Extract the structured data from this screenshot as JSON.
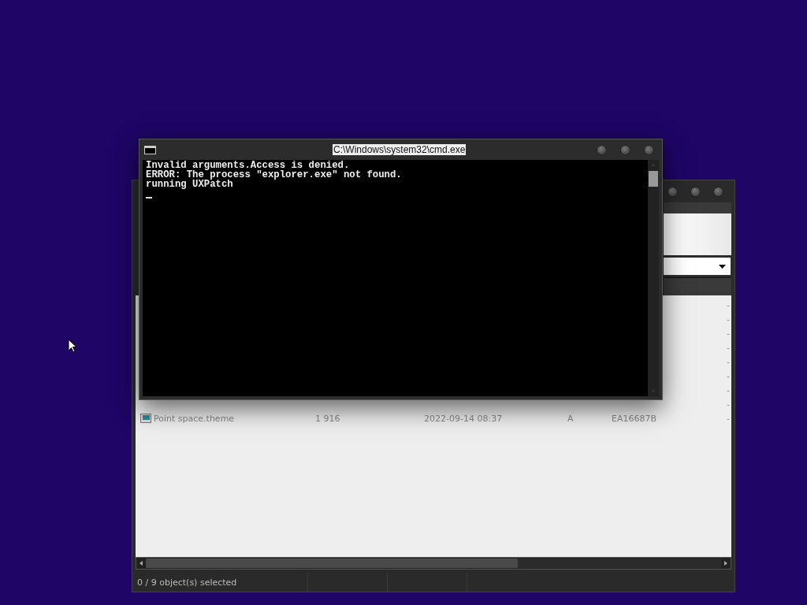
{
  "explorer_window": {
    "rows": [
      {
        "column_6": "-"
      },
      {
        "column_6": "-"
      },
      {
        "column_6": "-"
      },
      {
        "column_6": "-"
      },
      {
        "column_6": "-"
      },
      {
        "column_6": "-"
      },
      {
        "column_6": "-"
      },
      {
        "column_6": "-"
      },
      {
        "kind": "file",
        "name": "Point space.theme",
        "size": "1 916",
        "date": "2022-09-14 08:37",
        "attributes": "A",
        "crc": "EA16687B",
        "column_6": "-"
      }
    ],
    "status_bar": "0 / 9 object(s) selected"
  },
  "cmd_window": {
    "title": "C:\\Windows\\system32\\cmd.exe",
    "lines": [
      "Invalid arguments.Access is denied.",
      "ERROR: The process \"explorer.exe\" not found.",
      "running UXPatch"
    ],
    "cursor": true
  }
}
